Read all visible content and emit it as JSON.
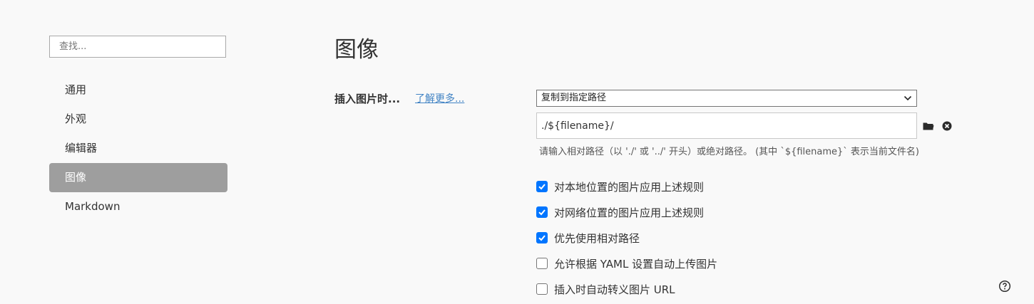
{
  "sidebar": {
    "search_placeholder": "查找...",
    "items": [
      {
        "label": "通用",
        "active": false
      },
      {
        "label": "外观",
        "active": false
      },
      {
        "label": "编辑器",
        "active": false
      },
      {
        "label": "图像",
        "active": true
      },
      {
        "label": "Markdown",
        "active": false
      }
    ]
  },
  "main": {
    "title": "图像",
    "insert_image": {
      "label": "插入图片时...",
      "learn_more": "了解更多...",
      "selected_option": "复制到指定路径",
      "path_value": "./${filename}/",
      "hint": "请输入相对路径（以 './' 或 '../' 开头）或绝对路径。 (其中 `${filename}` 表示当前文件名)"
    },
    "options": [
      {
        "label": "对本地位置的图片应用上述规则",
        "checked": true
      },
      {
        "label": "对网络位置的图片应用上述规则",
        "checked": true
      },
      {
        "label": "优先使用相对路径",
        "checked": true
      },
      {
        "label": "允许根据 YAML 设置自动上传图片",
        "checked": false
      },
      {
        "label": "插入时自动转义图片 URL",
        "checked": false
      }
    ]
  },
  "colors": {
    "accent": "#0075ff",
    "link": "#4183c4",
    "active_nav_bg": "#9e9e9e",
    "background": "#f9f9f9"
  },
  "icons": {
    "folder": "folder-icon",
    "clear": "close-circle-icon",
    "dropdown": "chevron-down-icon",
    "help": "help-circle-icon",
    "check": "checkmark-icon"
  }
}
